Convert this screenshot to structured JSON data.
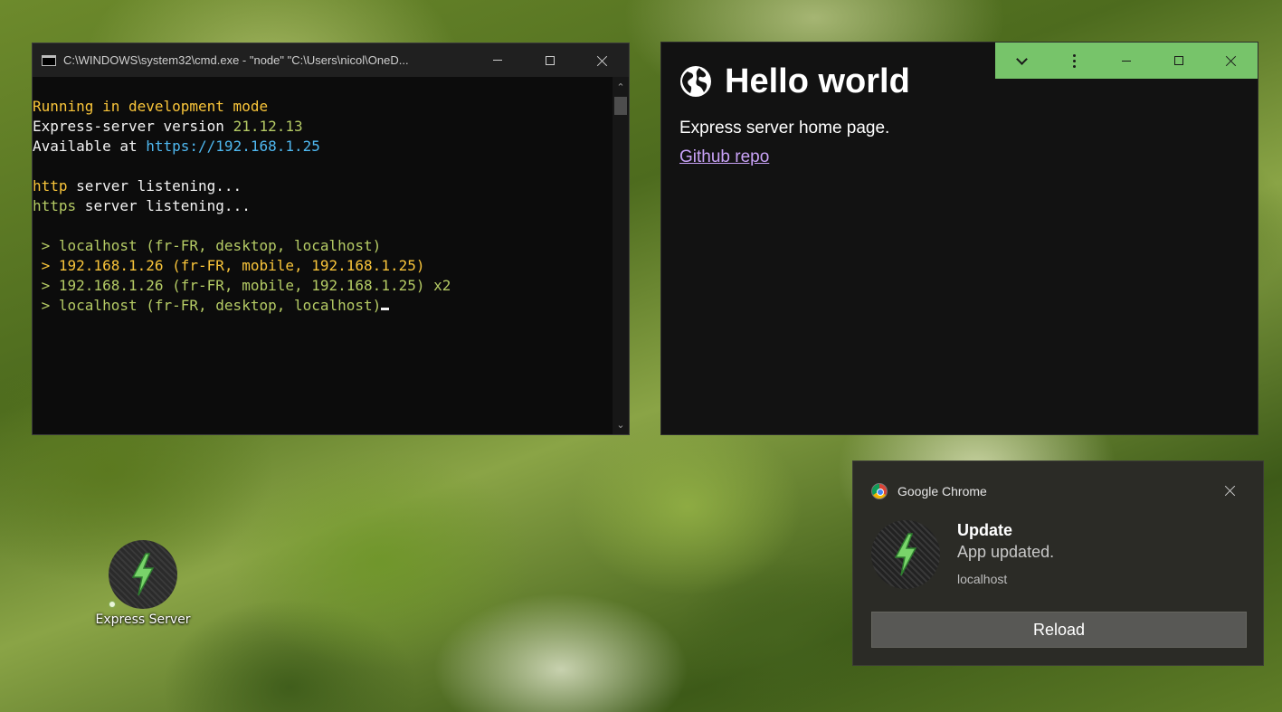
{
  "cmd": {
    "title": "C:\\WINDOWS\\system32\\cmd.exe  - \"node\"   \"C:\\Users\\nicol\\OneD...",
    "lines": [
      [
        {
          "t": "Running in development mode",
          "c": "c-yellow"
        }
      ],
      [
        {
          "t": "Express-server version ",
          "c": "c-white"
        },
        {
          "t": "21.12.13",
          "c": "c-green"
        }
      ],
      [
        {
          "t": "Available at ",
          "c": "c-white"
        },
        {
          "t": "https://192.168.1.25",
          "c": "c-blue"
        }
      ],
      [],
      [
        {
          "t": "http",
          "c": "c-yellow"
        },
        {
          "t": " server listening...",
          "c": "c-white"
        }
      ],
      [
        {
          "t": "https",
          "c": "c-green"
        },
        {
          "t": " server listening...",
          "c": "c-white"
        }
      ],
      [],
      [
        {
          "t": " > localhost (fr-FR, desktop, localhost)",
          "c": "c-green"
        }
      ],
      [
        {
          "t": " > 192.168.1.26 (fr-FR, mobile, 192.168.1.25)",
          "c": "c-yellow"
        }
      ],
      [
        {
          "t": " > 192.168.1.26 (fr-FR, mobile, 192.168.1.25) x2",
          "c": "c-green"
        }
      ],
      [
        {
          "t": " > localhost (fr-FR, desktop, localhost)",
          "c": "c-green"
        }
      ]
    ]
  },
  "app": {
    "heading": "Hello world",
    "description": "Express server home page.",
    "link_label": "Github repo",
    "titlebar_color": "#77c46a"
  },
  "desktop": {
    "shortcut_label": "Express Server",
    "shortcut_icon": "lightning-bolt-icon"
  },
  "notification": {
    "app_name": "Google Chrome",
    "title": "Update",
    "message": "App updated.",
    "source": "localhost",
    "button_label": "Reload"
  }
}
